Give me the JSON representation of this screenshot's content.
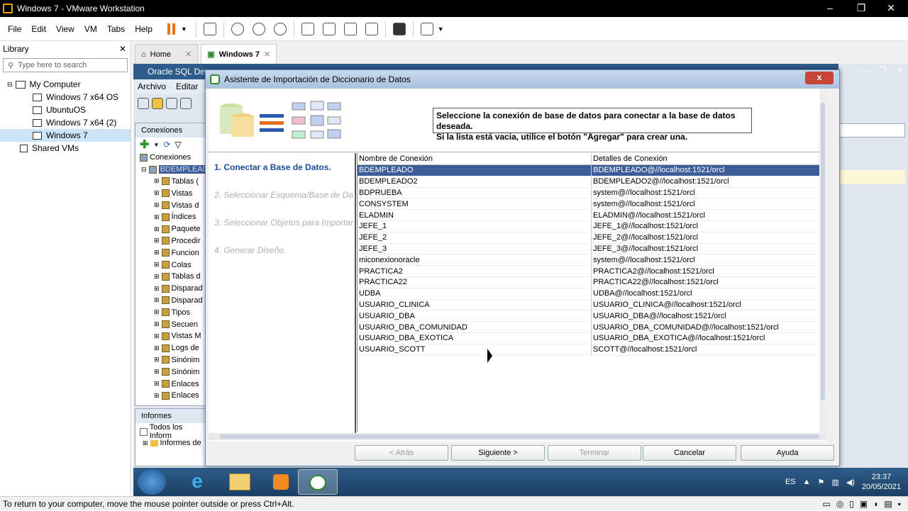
{
  "host": {
    "window_title": "Windows 7 - VMware Workstation",
    "menu": [
      "File",
      "Edit",
      "View",
      "VM",
      "Tabs",
      "Help"
    ],
    "library": {
      "title": "Library",
      "search_placeholder": "Type here to search",
      "tree": [
        {
          "label": "My Computer",
          "level": 0
        },
        {
          "label": "Windows 7 x64 OS",
          "level": 1
        },
        {
          "label": "UbuntuOS",
          "level": 1
        },
        {
          "label": "Windows 7 x64 (2)",
          "level": 1
        },
        {
          "label": "Windows 7",
          "level": 1,
          "selected": true
        },
        {
          "label": "Shared VMs",
          "level": 0
        }
      ]
    },
    "tabs": [
      {
        "label": "Home",
        "active": false
      },
      {
        "label": "Windows 7",
        "active": true
      }
    ],
    "status_text": "To return to your computer, move the mouse pointer outside or press Ctrl+Alt."
  },
  "guest": {
    "app_title": "Oracle SQL Dev",
    "app_menu": [
      "Archivo",
      "Editar"
    ],
    "conn_panel_title": "Conexiones",
    "conn_root": "Conexiones",
    "conn_selected": "BDEMPLEADO",
    "nav_items": [
      "Tablas (",
      "Vistas",
      "Vistas d",
      "Índices",
      "Paquete",
      "Procedir",
      "Funcion",
      "Colas",
      "Tablas d",
      "Disparad",
      "Disparad",
      "Tipos",
      "Secuen",
      "Vistas M",
      "Logs de",
      "Sinónim",
      "Sinónim",
      "Enlaces",
      "Enlaces"
    ],
    "informes_title": "Informes",
    "informes_items": [
      "Todos los Inform",
      "Informes de"
    ],
    "taskbar": {
      "lang": "ES",
      "time": "23:37",
      "date": "20/05/2021"
    }
  },
  "dialog": {
    "title": "Asistente de Importación de Diccionario de Datos",
    "close_label": "x",
    "instruction_line1": "Seleccione la conexión de base de datos para conectar a la base de datos deseada.",
    "instruction_line2": "Si la lista está vacia, utilice el botón \"Agregar\" para crear una.",
    "steps": [
      {
        "label": "1. Conectar a Base de Datos.",
        "active": true
      },
      {
        "label": "2. Seleccionar Esquema/Base de Da",
        "active": false
      },
      {
        "label": "3. Seleccionar Objetos para Importar",
        "active": false
      },
      {
        "label": "4. Generar Diseño.",
        "active": false
      }
    ],
    "columns": [
      "Nombre de Conexión",
      "Detalles de Conexión"
    ],
    "rows": [
      [
        "BDEMPLEADO",
        "BDEMPLEADO@//localhost:1521/orcl"
      ],
      [
        "BDEMPLEADO2",
        "BDEMPLEADO2@//localhost:1521/orcl"
      ],
      [
        "BDPRUEBA",
        "system@//localhost:1521/orcl"
      ],
      [
        "CONSYSTEM",
        "system@//localhost:1521/orcl"
      ],
      [
        "ELADMIN",
        "ELADMIN@//localhost:1521/orcl"
      ],
      [
        "JEFE_1",
        "JEFE_1@//localhost:1521/orcl"
      ],
      [
        "JEFE_2",
        "JEFE_2@//localhost:1521/orcl"
      ],
      [
        "JEFE_3",
        "JEFE_3@//localhost:1521/orcl"
      ],
      [
        "miconexionoracle",
        "system@//localhost:1521/orcl"
      ],
      [
        "PRACTICA2",
        "PRACTICA2@//localhost:1521/orcl"
      ],
      [
        "PRACTICA22",
        "PRACTICA22@//localhost:1521/orcl"
      ],
      [
        "UDBA",
        "UDBA@//localhost:1521/orcl"
      ],
      [
        "USUARIO_CLINICA",
        "USUARIO_CLINICA@//localhost:1521/orcl"
      ],
      [
        "USUARIO_DBA",
        "USUARIO_DBA@//localhost:1521/orcl"
      ],
      [
        "USUARIO_DBA_COMUNIDAD",
        "USUARIO_DBA_COMUNIDAD@//localhost:1521/orcl"
      ],
      [
        "USUARIO_DBA_EXOTICA",
        "USUARIO_DBA_EXOTICA@//localhost:1521/orcl"
      ],
      [
        "USUARIO_SCOTT",
        "SCOTT@//localhost:1521/orcl"
      ]
    ],
    "selected_row": 0,
    "buttons": {
      "back": "< Atrás",
      "next": "Siguiente >",
      "finish": "Terminar",
      "cancel": "Cancelar",
      "help": "Ayuda"
    }
  },
  "colors": {
    "selection": "#3c5d99",
    "step_active": "#1c4b9a",
    "vm_accent": "#e8741c"
  }
}
